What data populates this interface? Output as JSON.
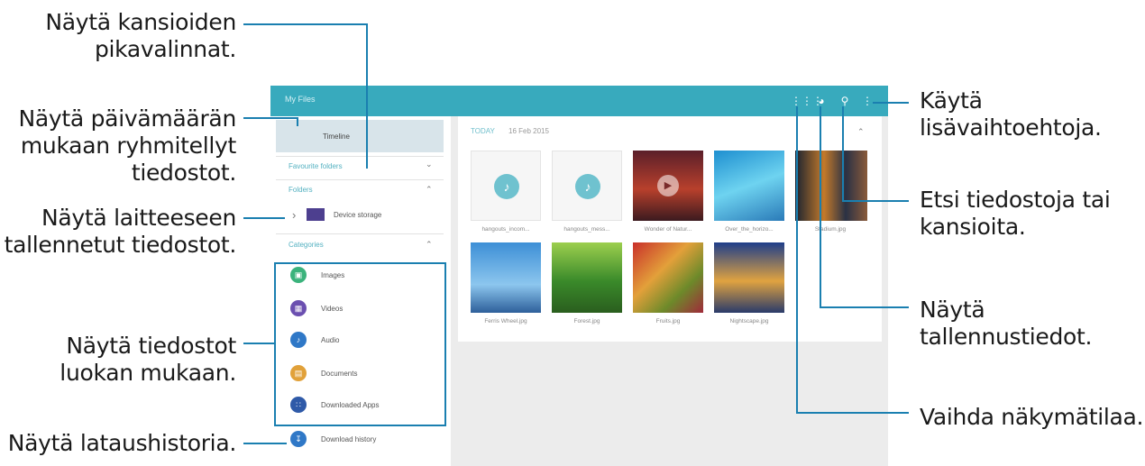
{
  "app": {
    "title": "My Files",
    "toolbar_icons": [
      "grid-view-icon",
      "storage-pie-icon",
      "search-icon",
      "more-options-icon"
    ]
  },
  "sidebar": {
    "timeline": "Timeline",
    "favourite_folders": "Favourite folders",
    "folders": "Folders",
    "device_storage": "Device storage",
    "categories": "Categories",
    "category_items": [
      {
        "label": "Images",
        "icon": "image-icon",
        "color": "#3bb37c"
      },
      {
        "label": "Videos",
        "icon": "video-icon",
        "color": "#6b4fb0"
      },
      {
        "label": "Audio",
        "icon": "music-note-icon",
        "color": "#2f78c7"
      },
      {
        "label": "Documents",
        "icon": "document-icon",
        "color": "#e1a13a"
      },
      {
        "label": "Downloaded Apps",
        "icon": "apps-icon",
        "color": "#2f5aa8"
      }
    ],
    "download_history": "Download history"
  },
  "main": {
    "today": "TODAY",
    "date": "16 Feb 2015",
    "files": [
      {
        "name": "hangouts_incom..."
      },
      {
        "name": "hangouts_mess..."
      },
      {
        "name": "Wonder of Natur..."
      },
      {
        "name": "Over_the_horizo..."
      },
      {
        "name": "Stadium.jpg"
      },
      {
        "name": "Ferris Wheel.jpg"
      },
      {
        "name": "Forest.jpg"
      },
      {
        "name": "Fruits.jpg"
      },
      {
        "name": "Nightscape.jpg"
      }
    ]
  },
  "callouts": {
    "folder_shortcuts": [
      "Näytä kansioiden",
      "pikavalinnat."
    ],
    "by_date": [
      "Näytä päivämäärän",
      "mukaan ryhmitellyt",
      "tiedostot."
    ],
    "device_files": [
      "Näytä laitteeseen",
      "tallennetut tiedostot."
    ],
    "by_category": [
      "Näytä tiedostot",
      "luokan mukaan."
    ],
    "download_history": [
      "Näytä lataushistoria."
    ],
    "more_options": [
      "Käytä",
      "lisävaihtoehtoja."
    ],
    "search": [
      "Etsi tiedostoja tai",
      "kansioita."
    ],
    "storage_info": [
      "Näytä",
      "tallennustiedot."
    ],
    "view_mode": [
      "Vaihda näkymätilaa."
    ]
  },
  "colors": {
    "appbar": "#38aabd",
    "callout_line": "#1a7fb0",
    "accent": "#54b1c1"
  }
}
